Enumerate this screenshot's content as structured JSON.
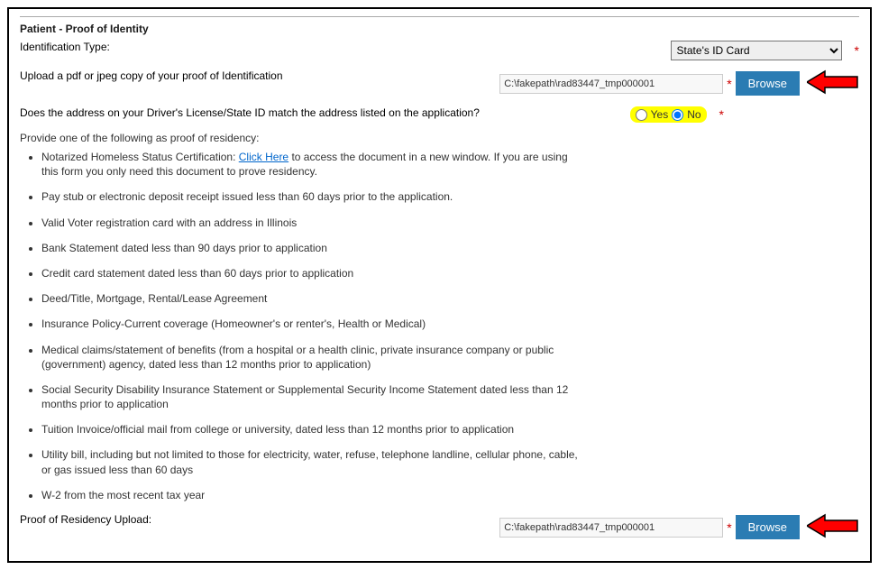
{
  "section_title": "Patient - Proof of Identity",
  "labels": {
    "identification_type": "Identification Type:",
    "upload_id": "Upload a pdf or jpeg copy of your proof of Identification",
    "address_match": "Does the address on your Driver's License/State ID match the address listed on the application?",
    "proof_residency_upload": "Proof of Residency Upload:",
    "provide_intro": "Provide one of the following as proof of residency:"
  },
  "id_type_select": {
    "value": "State's ID Card"
  },
  "file1": "C:\\fakepath\\rad83447_tmp000001",
  "file2": "C:\\fakepath\\rad83447_tmp000001",
  "browse_label": "Browse",
  "radio": {
    "yes": "Yes",
    "no": "No",
    "selected": "no"
  },
  "click_here": "Click Here",
  "proof_items_prefix": "Notarized Homeless Status Certification: ",
  "proof_items_suffix": " to access the document in a new window. If you are using this form you only need this document to prove residency.",
  "proof_items": [
    "Pay stub or electronic deposit receipt issued less than 60 days prior to the application.",
    "Valid Voter registration card with an address in Illinois",
    "Bank Statement dated less than 90 days prior to application",
    "Credit card statement dated less than 60 days prior to application",
    "Deed/Title, Mortgage, Rental/Lease Agreement",
    "Insurance Policy-Current coverage (Homeowner's or renter's, Health or Medical)",
    "Medical claims/statement of benefits (from a hospital or a health clinic, private insurance company or public (government) agency, dated less than 12 months prior to application)",
    "Social Security Disability Insurance Statement or Supplemental Security Income Statement dated less than 12 months prior to application",
    "Tuition Invoice/official mail from college or university, dated less than 12 months prior to application",
    "Utility bill, including but not limited to those for electricity, water, refuse, telephone landline, cellular phone, cable, or gas issued less than 60 days",
    "W-2 from the most recent tax year"
  ]
}
